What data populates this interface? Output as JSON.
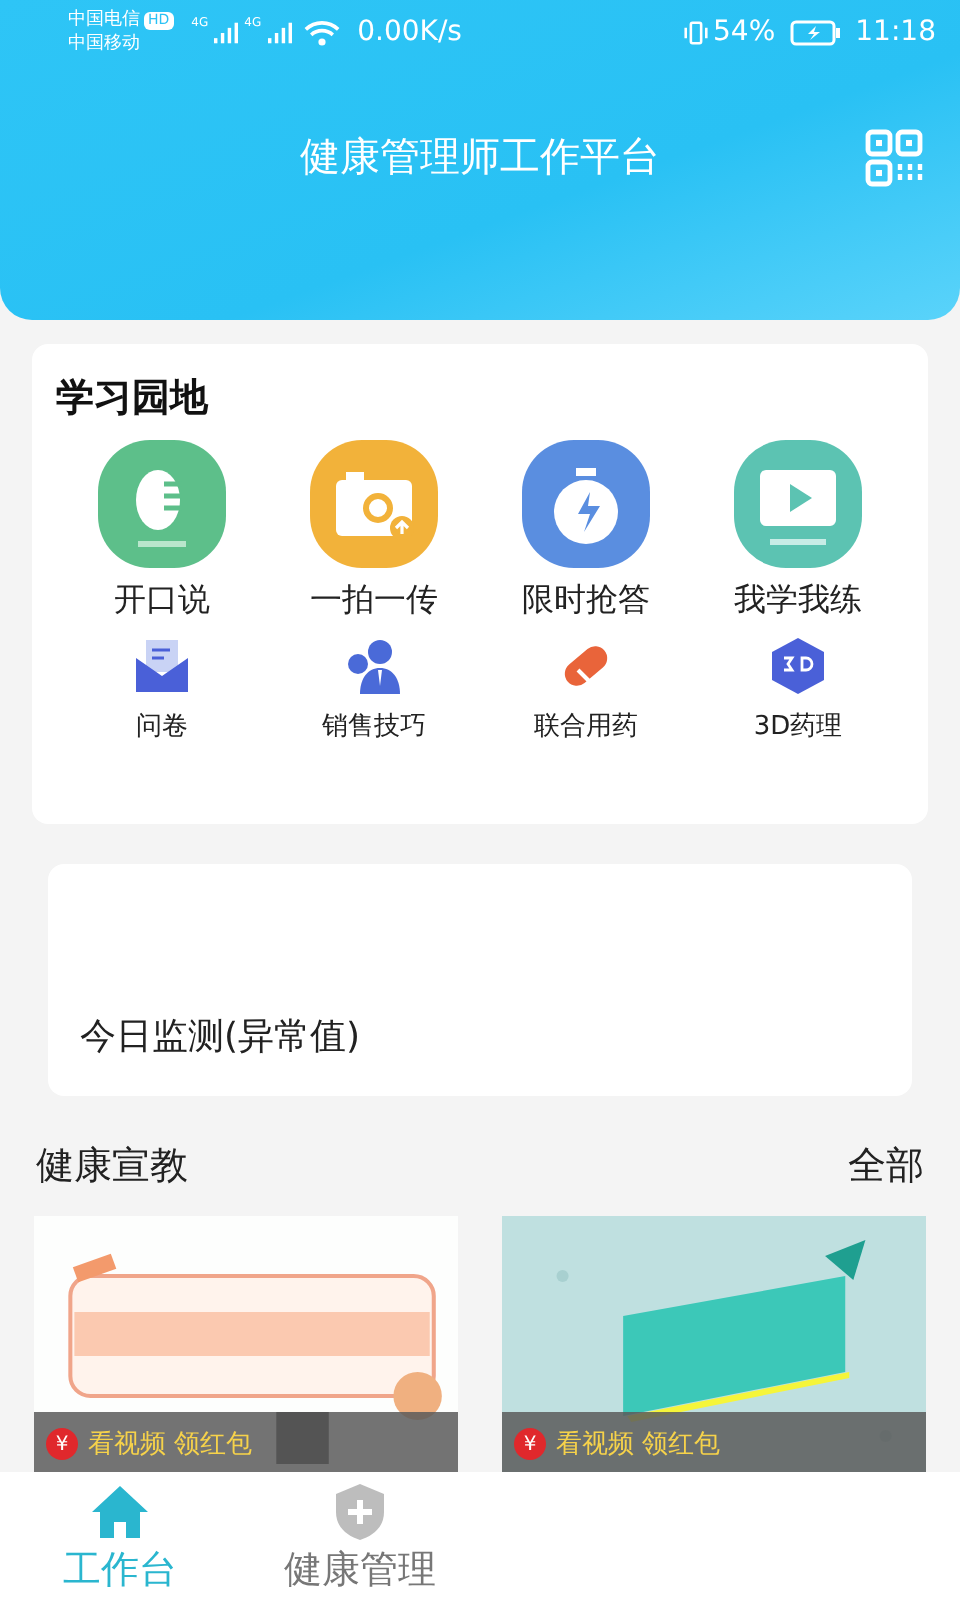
{
  "status_bar": {
    "carrier_1": "中国电信",
    "hd_badge": "HD",
    "carrier_2": "中国移动",
    "net_1": "4G",
    "net_2": "4G",
    "speed": "0.00K/s",
    "battery": "54%",
    "time": "11:18"
  },
  "header": {
    "title": "健康管理师工作平台"
  },
  "study": {
    "title": "学习园地",
    "main_items": [
      {
        "label": "开口说",
        "kind": "speak",
        "color": "#5dbf8a"
      },
      {
        "label": "一拍一传",
        "kind": "camera",
        "color": "#f2b23a"
      },
      {
        "label": "限时抢答",
        "kind": "timer",
        "color": "#5a8ee0"
      },
      {
        "label": "我学我练",
        "kind": "video",
        "color": "#5cc3b2"
      }
    ],
    "sub_items": [
      {
        "label": "问卷",
        "kind": "mail"
      },
      {
        "label": "销售技巧",
        "kind": "person"
      },
      {
        "label": "联合用药",
        "kind": "pill"
      },
      {
        "label": "3D药理",
        "kind": "cube"
      }
    ]
  },
  "monitor": {
    "title": "今日监测(异常值)"
  },
  "education": {
    "title": "健康宣教",
    "more": "全部",
    "videos": [
      {
        "kind": "picture",
        "reward": "看视频 领红包",
        "reward_icon": "¥"
      },
      {
        "kind": "picture",
        "reward": "看视频 领红包",
        "reward_icon": "¥"
      }
    ]
  },
  "tabs": [
    {
      "label": "工作台",
      "selected": true,
      "kind": "home"
    },
    {
      "label": "健康管理",
      "selected": false,
      "kind": "shield"
    }
  ]
}
